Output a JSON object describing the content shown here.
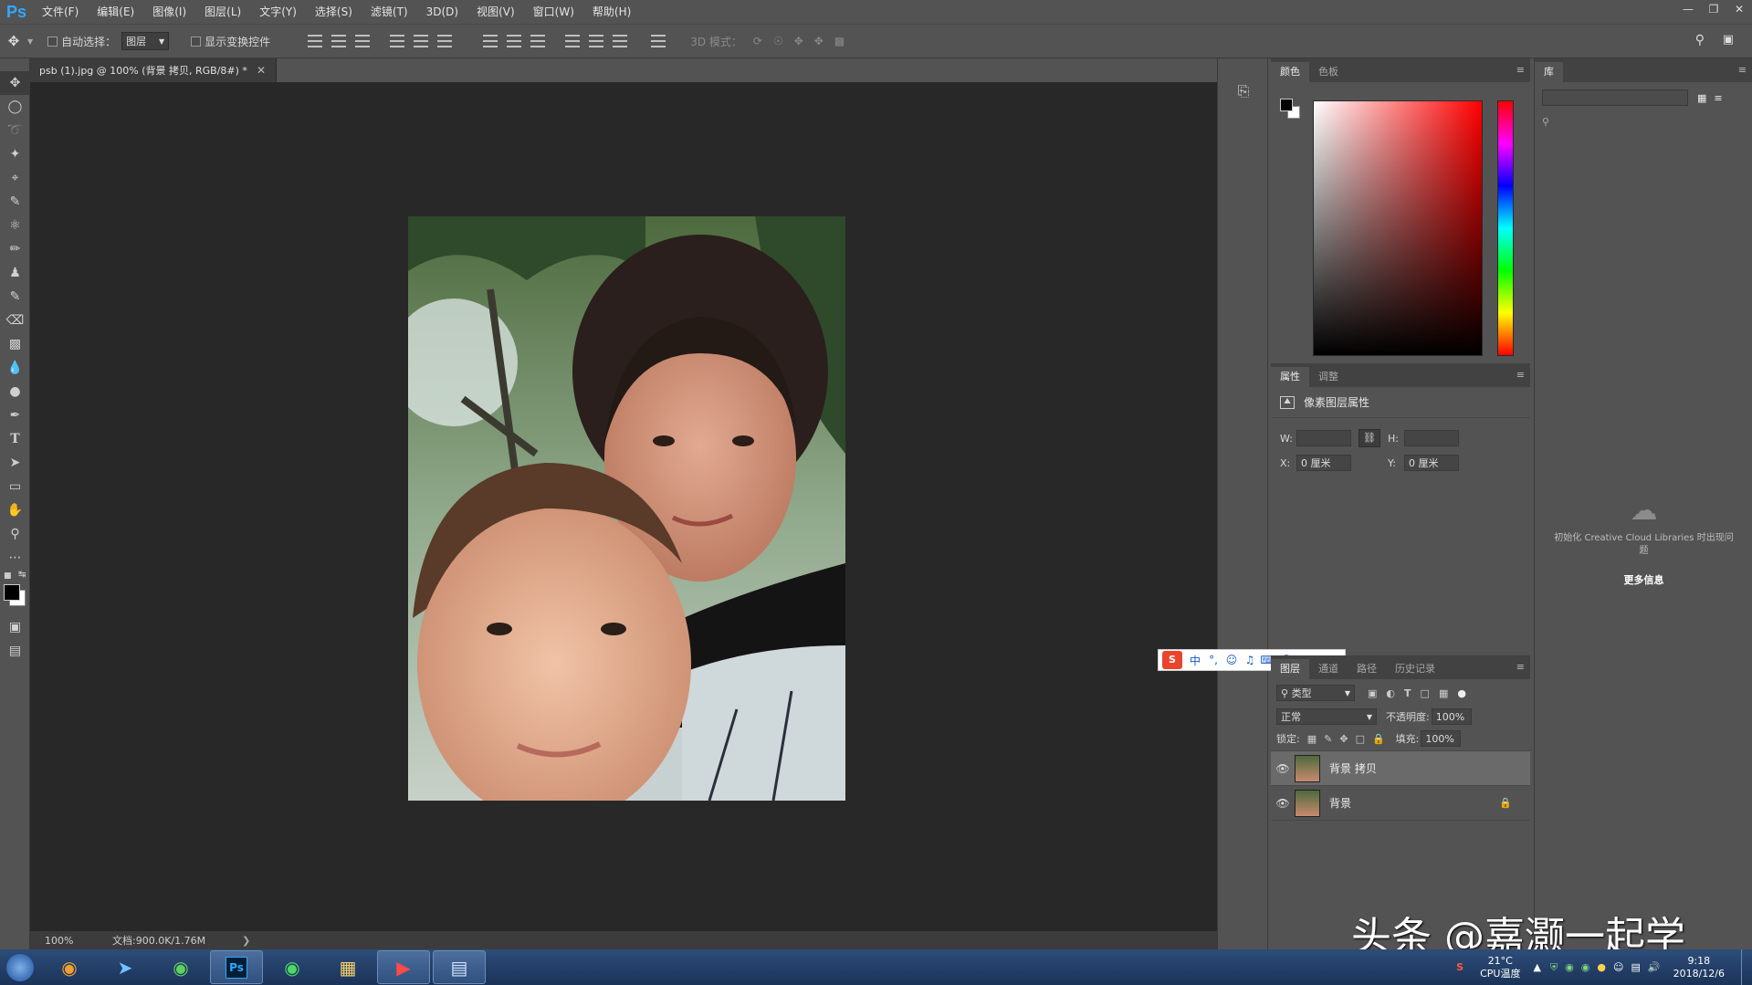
{
  "app": {
    "logo": "Ps"
  },
  "menu": [
    "文件(F)",
    "编辑(E)",
    "图像(I)",
    "图层(L)",
    "文字(Y)",
    "选择(S)",
    "滤镜(T)",
    "3D(D)",
    "视图(V)",
    "窗口(W)",
    "帮助(H)"
  ],
  "options": {
    "auto_select_label": "自动选择：",
    "auto_select_value": "图层",
    "transform_label": "显示变换控件",
    "mode3d_label": "3D 模式："
  },
  "document": {
    "tab_title": "psb (1).jpg @ 100% (背景 拷贝, RGB/8#) *",
    "zoom": "100%",
    "doc_info": "文档:900.0K/1.76M"
  },
  "color_panel": {
    "tabs": [
      "颜色",
      "色板"
    ],
    "fg_color": "#000000",
    "bg_color": "#ffffff"
  },
  "props_panel": {
    "tabs": [
      "属性",
      "调整"
    ],
    "title": "像素图层属性",
    "w_label": "W:",
    "h_label": "H:",
    "x_label": "X:",
    "x_value": "0 厘米",
    "y_label": "Y:",
    "y_value": "0 厘米"
  },
  "layers_panel": {
    "tabs": [
      "图层",
      "通道",
      "路径",
      "历史记录"
    ],
    "filter_label": "类型",
    "blend_mode": "正常",
    "opacity_label": "不透明度:",
    "opacity_value": "100%",
    "lock_label": "锁定:",
    "fill_label": "填充:",
    "fill_value": "100%",
    "layers": [
      {
        "name": "背景 拷贝",
        "selected": true
      },
      {
        "name": "背景",
        "selected": false
      }
    ]
  },
  "library_panel": {
    "tab": "库",
    "message": "初始化 Creative Cloud Libraries 时出现问题",
    "more_info": "更多信息"
  },
  "tray": {
    "temp": "21°C",
    "cpu_label": "CPU温度",
    "time": "9:18",
    "date": "2018/12/6"
  },
  "watermark": "头条 @嘉灏一起学"
}
